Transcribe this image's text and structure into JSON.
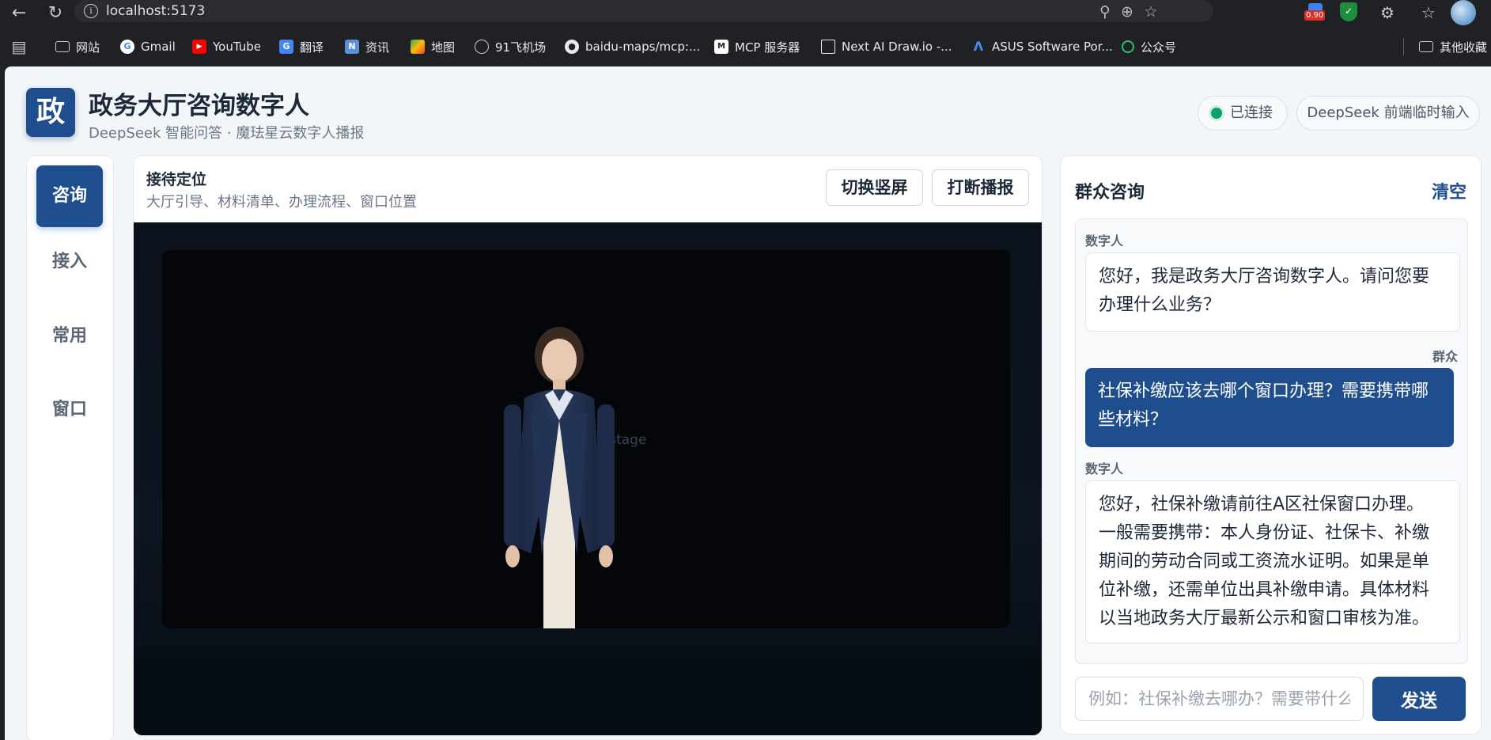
{
  "browser": {
    "url": "localhost:5173",
    "zoom_badge": "0.90",
    "bookmarks": [
      {
        "label": "网站",
        "icon": "folder-icon"
      },
      {
        "label": "Gmail",
        "icon": "google-icon"
      },
      {
        "label": "YouTube",
        "icon": "youtube-icon"
      },
      {
        "label": "翻译",
        "icon": "translate-icon"
      },
      {
        "label": "资讯",
        "icon": "news-icon"
      },
      {
        "label": "地图",
        "icon": "maps-icon"
      },
      {
        "label": "91飞机场",
        "icon": "globe-icon"
      },
      {
        "label": "baidu-maps/mcp:...",
        "icon": "github-icon"
      },
      {
        "label": "MCP 服务器",
        "icon": "mcp-icon"
      },
      {
        "label": "Next AI Draw.io -...",
        "icon": "drawio-icon"
      },
      {
        "label": "ASUS Software Por...",
        "icon": "asus-icon"
      },
      {
        "label": "公众号",
        "icon": "wechat-icon"
      },
      {
        "label": "其他收藏",
        "icon": "folder-icon"
      }
    ]
  },
  "header": {
    "logo_char": "政",
    "title": "政务大厅咨询数字人",
    "subtitle": "DeepSeek 智能问答 · 魔珐星云数字人播报",
    "status": "已连接",
    "mode": "DeepSeek 前端临时输入"
  },
  "nav": {
    "items": [
      {
        "label": "咨询",
        "active": true
      },
      {
        "label": "接入",
        "active": false
      },
      {
        "label": "常用",
        "active": false
      },
      {
        "label": "窗口",
        "active": false
      }
    ]
  },
  "stage": {
    "title": "接待定位",
    "subtitle": "大厅引导、材料清单、办理流程、窗口位置",
    "switch_label": "切换竖屏",
    "interrupt_label": "打断播报",
    "placeholder": "Digital human stage"
  },
  "chat": {
    "title": "群众咨询",
    "clear_label": "清空",
    "messages": [
      {
        "role": "数字人",
        "lines": [
          "您好，我是政务大厅咨询数字人。请问您要",
          "办理什么业务？"
        ]
      },
      {
        "role": "群众",
        "lines": [
          "社保补缴应该去哪个窗口办理？需要携带哪",
          "些材料？"
        ]
      },
      {
        "role": "数字人",
        "lines": [
          "您好，社保补缴请前往A区社保窗口办理。",
          "一般需要携带：本人身份证、社保卡、补缴",
          "期间的劳动合同或工资流水证明。如果是单",
          "位补缴，还需单位出具补缴申请。具体材料",
          "以当地政务大厅最新公示和窗口审核为准。"
        ]
      }
    ],
    "input_placeholder": "例如：社保补缴去哪办？需要带什么？",
    "send_label": "发送"
  }
}
